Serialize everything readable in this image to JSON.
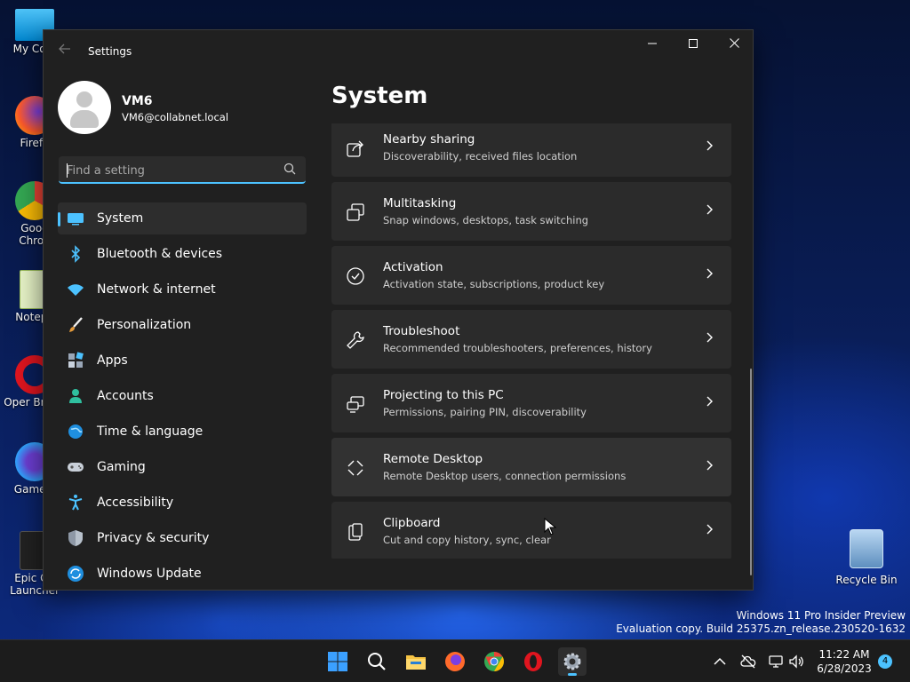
{
  "desktop": {
    "icons": [
      {
        "label": "My Com"
      },
      {
        "label": "Firefo"
      },
      {
        "label": "Goog Chron"
      },
      {
        "label": "Notepa"
      },
      {
        "label": "Oper Brows"
      },
      {
        "label": "Gamelo"
      },
      {
        "label": "Epic Ga Launcher"
      }
    ],
    "recycle_bin": "Recycle Bin",
    "watermark_line1": "Windows 11 Pro Insider Preview",
    "watermark_line2": "Evaluation copy. Build 25375.zn_release.230520-1632"
  },
  "window": {
    "title": "Settings",
    "minimize_label": "─",
    "maximize_label": "☐",
    "close_label": "✕"
  },
  "user": {
    "name": "VM6",
    "email": "VM6@collabnet.local"
  },
  "search": {
    "placeholder": "Find a setting",
    "value": ""
  },
  "nav": {
    "items": [
      {
        "label": "System",
        "icon": "monitor-icon",
        "active": true
      },
      {
        "label": "Bluetooth & devices",
        "icon": "bluetooth-icon"
      },
      {
        "label": "Network & internet",
        "icon": "wifi-icon"
      },
      {
        "label": "Personalization",
        "icon": "brush-icon"
      },
      {
        "label": "Apps",
        "icon": "apps-icon"
      },
      {
        "label": "Accounts",
        "icon": "person-icon"
      },
      {
        "label": "Time & language",
        "icon": "globe-icon"
      },
      {
        "label": "Gaming",
        "icon": "gamepad-icon"
      },
      {
        "label": "Accessibility",
        "icon": "accessibility-icon"
      },
      {
        "label": "Privacy & security",
        "icon": "shield-icon"
      },
      {
        "label": "Windows Update",
        "icon": "update-icon"
      }
    ]
  },
  "page": {
    "title": "System",
    "cards": [
      {
        "title": "Nearby sharing",
        "subtitle": "Discoverability, received files location",
        "icon": "share-icon"
      },
      {
        "title": "Multitasking",
        "subtitle": "Snap windows, desktops, task switching",
        "icon": "multitask-icon"
      },
      {
        "title": "Activation",
        "subtitle": "Activation state, subscriptions, product key",
        "icon": "check-circle-icon"
      },
      {
        "title": "Troubleshoot",
        "subtitle": "Recommended troubleshooters, preferences, history",
        "icon": "wrench-icon"
      },
      {
        "title": "Projecting to this PC",
        "subtitle": "Permissions, pairing PIN, discoverability",
        "icon": "projector-icon"
      },
      {
        "title": "Remote Desktop",
        "subtitle": "Remote Desktop users, connection permissions",
        "icon": "remote-desktop-icon"
      },
      {
        "title": "Clipboard",
        "subtitle": "Cut and copy history, sync, clear",
        "icon": "clipboard-icon"
      }
    ]
  },
  "taskbar": {
    "time": "11:22 AM",
    "date": "6/28/2023",
    "notification_count": "4"
  },
  "colors": {
    "accent": "#4cc2ff",
    "window_bg": "#202020",
    "card_bg": "#2b2b2b"
  }
}
